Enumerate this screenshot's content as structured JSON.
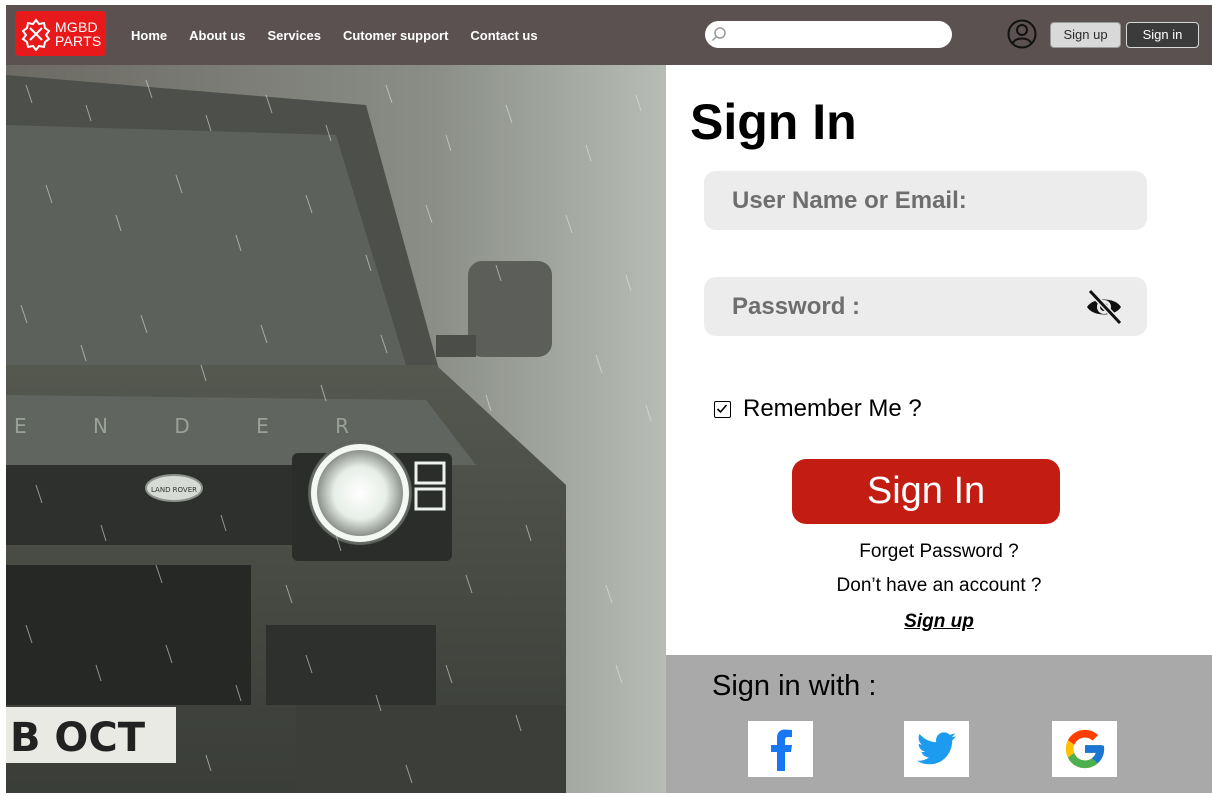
{
  "header": {
    "logo_line1": "MGBD",
    "logo_line2": "PARTS",
    "nav": [
      "Home",
      "About us",
      "Services",
      "Cutomer support",
      "Contact us"
    ],
    "search_placeholder": "",
    "signup_label": "Sign up",
    "signin_label": "Sign in"
  },
  "hero": {
    "plate_text": "B OCT",
    "badge_text": "LAND ROVER",
    "grille_text": "E N D E R"
  },
  "form": {
    "title": "Sign In",
    "username_placeholder": "User Name or Email:",
    "password_placeholder": "Password :",
    "remember_label": "Remember Me ?",
    "remember_checked": true,
    "submit_label": "Sign In",
    "forgot_label": "Forget Password ?",
    "no_account_label": "Don’t have an account ?",
    "signup_link": "Sign up"
  },
  "social": {
    "title": "Sign in with :",
    "providers": [
      "facebook",
      "twitter",
      "google"
    ]
  },
  "colors": {
    "header_bg": "#5a5150",
    "logo_red": "#e8191a",
    "primary_button": "#c31c12",
    "social_panel": "#a9a9a9",
    "input_bg": "#ececec"
  }
}
